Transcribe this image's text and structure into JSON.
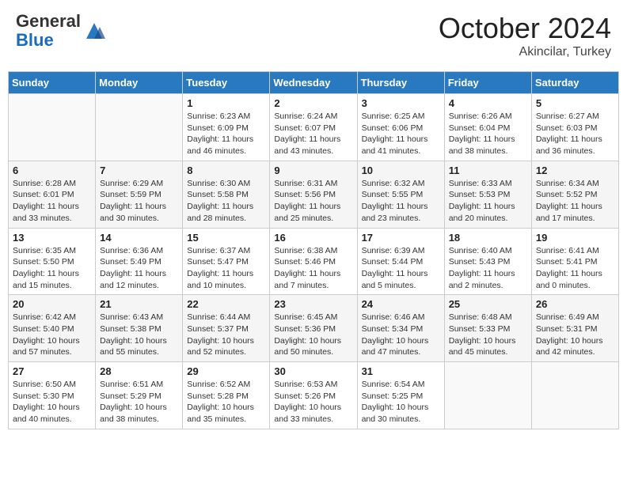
{
  "header": {
    "logo_general": "General",
    "logo_blue": "Blue",
    "month_title": "October 2024",
    "location": "Akincilar, Turkey"
  },
  "weekdays": [
    "Sunday",
    "Monday",
    "Tuesday",
    "Wednesday",
    "Thursday",
    "Friday",
    "Saturday"
  ],
  "weeks": [
    [
      {
        "day": "",
        "empty": true
      },
      {
        "day": "",
        "empty": true
      },
      {
        "day": "1",
        "sunrise": "Sunrise: 6:23 AM",
        "sunset": "Sunset: 6:09 PM",
        "daylight": "Daylight: 11 hours and 46 minutes."
      },
      {
        "day": "2",
        "sunrise": "Sunrise: 6:24 AM",
        "sunset": "Sunset: 6:07 PM",
        "daylight": "Daylight: 11 hours and 43 minutes."
      },
      {
        "day": "3",
        "sunrise": "Sunrise: 6:25 AM",
        "sunset": "Sunset: 6:06 PM",
        "daylight": "Daylight: 11 hours and 41 minutes."
      },
      {
        "day": "4",
        "sunrise": "Sunrise: 6:26 AM",
        "sunset": "Sunset: 6:04 PM",
        "daylight": "Daylight: 11 hours and 38 minutes."
      },
      {
        "day": "5",
        "sunrise": "Sunrise: 6:27 AM",
        "sunset": "Sunset: 6:03 PM",
        "daylight": "Daylight: 11 hours and 36 minutes."
      }
    ],
    [
      {
        "day": "6",
        "sunrise": "Sunrise: 6:28 AM",
        "sunset": "Sunset: 6:01 PM",
        "daylight": "Daylight: 11 hours and 33 minutes."
      },
      {
        "day": "7",
        "sunrise": "Sunrise: 6:29 AM",
        "sunset": "Sunset: 5:59 PM",
        "daylight": "Daylight: 11 hours and 30 minutes."
      },
      {
        "day": "8",
        "sunrise": "Sunrise: 6:30 AM",
        "sunset": "Sunset: 5:58 PM",
        "daylight": "Daylight: 11 hours and 28 minutes."
      },
      {
        "day": "9",
        "sunrise": "Sunrise: 6:31 AM",
        "sunset": "Sunset: 5:56 PM",
        "daylight": "Daylight: 11 hours and 25 minutes."
      },
      {
        "day": "10",
        "sunrise": "Sunrise: 6:32 AM",
        "sunset": "Sunset: 5:55 PM",
        "daylight": "Daylight: 11 hours and 23 minutes."
      },
      {
        "day": "11",
        "sunrise": "Sunrise: 6:33 AM",
        "sunset": "Sunset: 5:53 PM",
        "daylight": "Daylight: 11 hours and 20 minutes."
      },
      {
        "day": "12",
        "sunrise": "Sunrise: 6:34 AM",
        "sunset": "Sunset: 5:52 PM",
        "daylight": "Daylight: 11 hours and 17 minutes."
      }
    ],
    [
      {
        "day": "13",
        "sunrise": "Sunrise: 6:35 AM",
        "sunset": "Sunset: 5:50 PM",
        "daylight": "Daylight: 11 hours and 15 minutes."
      },
      {
        "day": "14",
        "sunrise": "Sunrise: 6:36 AM",
        "sunset": "Sunset: 5:49 PM",
        "daylight": "Daylight: 11 hours and 12 minutes."
      },
      {
        "day": "15",
        "sunrise": "Sunrise: 6:37 AM",
        "sunset": "Sunset: 5:47 PM",
        "daylight": "Daylight: 11 hours and 10 minutes."
      },
      {
        "day": "16",
        "sunrise": "Sunrise: 6:38 AM",
        "sunset": "Sunset: 5:46 PM",
        "daylight": "Daylight: 11 hours and 7 minutes."
      },
      {
        "day": "17",
        "sunrise": "Sunrise: 6:39 AM",
        "sunset": "Sunset: 5:44 PM",
        "daylight": "Daylight: 11 hours and 5 minutes."
      },
      {
        "day": "18",
        "sunrise": "Sunrise: 6:40 AM",
        "sunset": "Sunset: 5:43 PM",
        "daylight": "Daylight: 11 hours and 2 minutes."
      },
      {
        "day": "19",
        "sunrise": "Sunrise: 6:41 AM",
        "sunset": "Sunset: 5:41 PM",
        "daylight": "Daylight: 11 hours and 0 minutes."
      }
    ],
    [
      {
        "day": "20",
        "sunrise": "Sunrise: 6:42 AM",
        "sunset": "Sunset: 5:40 PM",
        "daylight": "Daylight: 10 hours and 57 minutes."
      },
      {
        "day": "21",
        "sunrise": "Sunrise: 6:43 AM",
        "sunset": "Sunset: 5:38 PM",
        "daylight": "Daylight: 10 hours and 55 minutes."
      },
      {
        "day": "22",
        "sunrise": "Sunrise: 6:44 AM",
        "sunset": "Sunset: 5:37 PM",
        "daylight": "Daylight: 10 hours and 52 minutes."
      },
      {
        "day": "23",
        "sunrise": "Sunrise: 6:45 AM",
        "sunset": "Sunset: 5:36 PM",
        "daylight": "Daylight: 10 hours and 50 minutes."
      },
      {
        "day": "24",
        "sunrise": "Sunrise: 6:46 AM",
        "sunset": "Sunset: 5:34 PM",
        "daylight": "Daylight: 10 hours and 47 minutes."
      },
      {
        "day": "25",
        "sunrise": "Sunrise: 6:48 AM",
        "sunset": "Sunset: 5:33 PM",
        "daylight": "Daylight: 10 hours and 45 minutes."
      },
      {
        "day": "26",
        "sunrise": "Sunrise: 6:49 AM",
        "sunset": "Sunset: 5:31 PM",
        "daylight": "Daylight: 10 hours and 42 minutes."
      }
    ],
    [
      {
        "day": "27",
        "sunrise": "Sunrise: 6:50 AM",
        "sunset": "Sunset: 5:30 PM",
        "daylight": "Daylight: 10 hours and 40 minutes."
      },
      {
        "day": "28",
        "sunrise": "Sunrise: 6:51 AM",
        "sunset": "Sunset: 5:29 PM",
        "daylight": "Daylight: 10 hours and 38 minutes."
      },
      {
        "day": "29",
        "sunrise": "Sunrise: 6:52 AM",
        "sunset": "Sunset: 5:28 PM",
        "daylight": "Daylight: 10 hours and 35 minutes."
      },
      {
        "day": "30",
        "sunrise": "Sunrise: 6:53 AM",
        "sunset": "Sunset: 5:26 PM",
        "daylight": "Daylight: 10 hours and 33 minutes."
      },
      {
        "day": "31",
        "sunrise": "Sunrise: 6:54 AM",
        "sunset": "Sunset: 5:25 PM",
        "daylight": "Daylight: 10 hours and 30 minutes."
      },
      {
        "day": "",
        "empty": true
      },
      {
        "day": "",
        "empty": true
      }
    ]
  ]
}
